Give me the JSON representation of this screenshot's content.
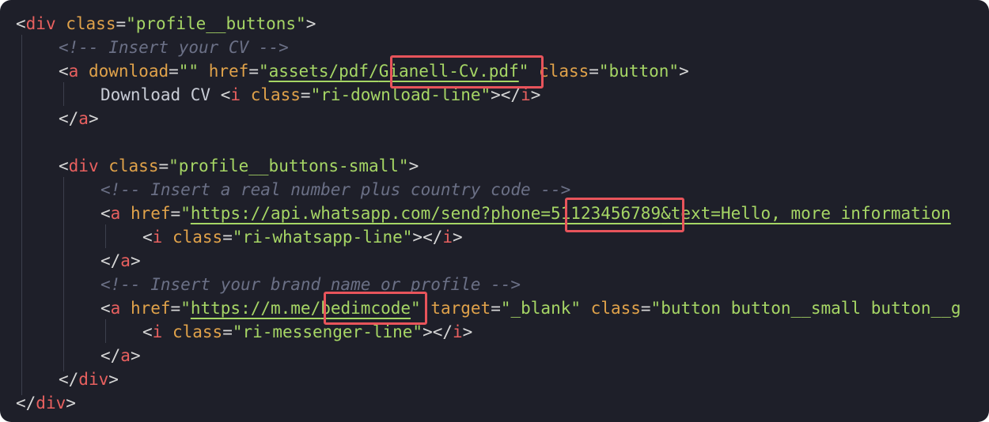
{
  "code": {
    "l1": {
      "open": "<",
      "tag": "div",
      "attr": "class",
      "eq": "=",
      "val": "\"profile__buttons\"",
      "close": ">"
    },
    "l2": {
      "comment": "<!-- Insert your CV -->"
    },
    "l3": {
      "open": "<",
      "tag": "a",
      "a1": "download",
      "eq1": "=",
      "v1": "\"\"",
      "a2": "href",
      "eq2": "=",
      "v2q": "\"",
      "v2a": "assets/pdf/",
      "v2b": "Gianell-Cv.pdf",
      "v2q2": "\"",
      "a3": "class",
      "eq3": "=",
      "v3": "\"button\"",
      "close": ">"
    },
    "l4": {
      "text": "Download CV ",
      "open": "<",
      "tag": "i",
      "attr": "class",
      "eq": "=",
      "val": "\"ri-download-line\"",
      "mid": "></",
      "tag2": "i",
      "close": ">"
    },
    "l5": {
      "open": "</",
      "tag": "a",
      "close": ">"
    },
    "l7": {
      "open": "<",
      "tag": "div",
      "attr": "class",
      "eq": "=",
      "val": "\"profile__buttons-small\"",
      "close": ">"
    },
    "l8": {
      "comment": "<!-- Insert a real number plus country code -->"
    },
    "l9": {
      "open": "<",
      "tag": "a",
      "attr": "href",
      "eq": "=",
      "q": "\"",
      "va": "https://api.whatsapp.com/send?phone=",
      "vb": "51123456789",
      "vc": "&text=Hello, more information"
    },
    "l10": {
      "open": "<",
      "tag": "i",
      "attr": "class",
      "eq": "=",
      "val": "\"ri-whatsapp-line\"",
      "mid": "></",
      "tag2": "i",
      "close": ">"
    },
    "l11": {
      "open": "</",
      "tag": "a",
      "close": ">"
    },
    "l12": {
      "comment": "<!-- Insert your brand name or profile -->"
    },
    "l13": {
      "open": "<",
      "tag": "a",
      "attr": "href",
      "eq": "=",
      "q": "\"",
      "va": "https://m.me/",
      "vb": "bedimcode",
      "q2": "\"",
      "a2": "target",
      "eq2": "=",
      "v2": "\"_blank\"",
      "a3": "class",
      "eq3": "=",
      "v3": "\"button button__small button__g"
    },
    "l14": {
      "open": "<",
      "tag": "i",
      "attr": "class",
      "eq": "=",
      "val": "\"ri-messenger-line\"",
      "mid": "></",
      "tag2": "i",
      "close": ">"
    },
    "l15": {
      "open": "</",
      "tag": "a",
      "close": ">"
    },
    "l16": {
      "open": "</",
      "tag": "div",
      "close": ">"
    },
    "l17": {
      "open": "</",
      "tag": "div",
      "close": ">"
    }
  },
  "colors": {
    "background": "#1e1f29",
    "tag": "#e8605f",
    "attribute": "#e0a24a",
    "string": "#a6d665",
    "comment": "#6b7086",
    "highlight_box": "#e8545b"
  }
}
